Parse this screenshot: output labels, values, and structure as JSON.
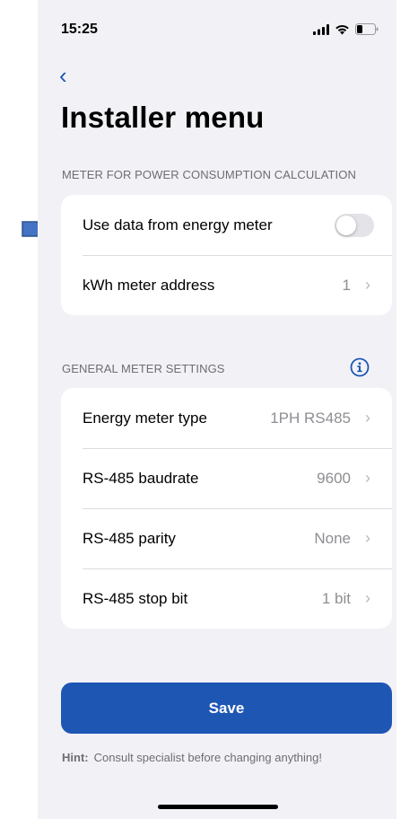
{
  "status_bar": {
    "time": "15:25",
    "icons": [
      "signal-icon",
      "wifi-icon",
      "battery-icon"
    ]
  },
  "nav": {
    "back_icon": "chevron-left-icon",
    "back_glyph": "‹"
  },
  "page": {
    "title": "Installer menu"
  },
  "section_meter": {
    "header": "METER FOR POWER CONSUMPTION CALCULATION",
    "rows": [
      {
        "label": "Use data from energy meter",
        "type": "toggle",
        "value": false
      },
      {
        "label": "kWh meter address",
        "value": "1"
      }
    ]
  },
  "section_general": {
    "header": "GENERAL METER SETTINGS",
    "info_icon": "info-icon",
    "rows": [
      {
        "label": "Energy meter type",
        "value": "1PH RS485"
      },
      {
        "label": "RS-485 baudrate",
        "value": "9600"
      },
      {
        "label": "RS-485 parity",
        "value": "None"
      },
      {
        "label": "RS-485 stop bit",
        "value": "1 bit"
      }
    ]
  },
  "chevron_glyph": "›",
  "save": {
    "label": "Save"
  },
  "hint": {
    "label": "Hint:",
    "text": "Consult specialist before changing anything!"
  },
  "colors": {
    "accent": "#1e56b4",
    "background": "#f2f2f6",
    "arrow_fill": "#4472c4",
    "arrow_stroke": "#2f528f"
  }
}
